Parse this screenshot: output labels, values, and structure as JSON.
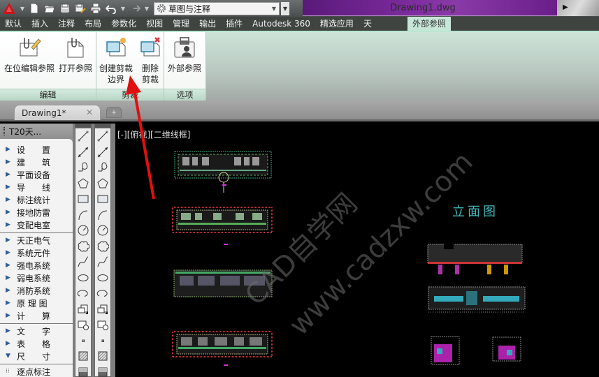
{
  "app": {
    "logo": "autocad-logo",
    "workspace": "草图与注释",
    "document_title": "Drawing1.dwg"
  },
  "quick_access": [
    {
      "icon": "new-file-icon"
    },
    {
      "icon": "open-folder-icon"
    },
    {
      "icon": "save-icon"
    },
    {
      "icon": "save-as-icon"
    },
    {
      "icon": "print-icon"
    },
    {
      "icon": "undo-icon"
    },
    {
      "icon": "redo-icon"
    }
  ],
  "ribbon_tabs": [
    {
      "label": "默认"
    },
    {
      "label": "插入"
    },
    {
      "label": "注释"
    },
    {
      "label": "布局"
    },
    {
      "label": "参数化"
    },
    {
      "label": "视图"
    },
    {
      "label": "管理"
    },
    {
      "label": "输出"
    },
    {
      "label": "插件"
    },
    {
      "label": "Autodesk 360"
    },
    {
      "label": "精选应用"
    },
    {
      "label": "天"
    },
    {
      "label": "外部参照",
      "active": true
    }
  ],
  "ribbon_panels": [
    {
      "title": "编辑",
      "buttons": [
        {
          "label": "在位编辑参照",
          "icon": "edit-reference-in-place-icon"
        },
        {
          "label": "打开参照",
          "icon": "open-reference-icon"
        }
      ]
    },
    {
      "title": "剪裁",
      "buttons": [
        {
          "label_line1": "创建剪裁",
          "label_line2": "边界",
          "icon": "create-clip-boundary-icon"
        },
        {
          "label_line1": "删除",
          "label_line2": "剪裁",
          "icon": "delete-clip-icon"
        }
      ]
    },
    {
      "title": "选项",
      "buttons": [
        {
          "label": "外部参照",
          "icon": "external-references-icon"
        }
      ]
    }
  ],
  "doc_tabs": [
    {
      "label": "Drawing1*",
      "active": true
    }
  ],
  "palette": {
    "title": "T20天...",
    "groups": [
      [
        {
          "a": "设",
          "b": "置"
        },
        {
          "a": "建",
          "b": "筑"
        },
        {
          "label": "平面设备"
        },
        {
          "a": "导",
          "b": "线"
        },
        {
          "label": "标注统计"
        },
        {
          "label": "接地防雷"
        },
        {
          "label": "变配电室"
        }
      ],
      [
        {
          "label": "天正电气"
        },
        {
          "label": "系统元件"
        },
        {
          "label": "强电系统"
        },
        {
          "label": "弱电系统"
        },
        {
          "label": "消防系统"
        },
        {
          "label": "原 理 图"
        },
        {
          "a": "计",
          "b": "算"
        }
      ],
      [
        {
          "a": "文",
          "b": "字"
        },
        {
          "a": "表",
          "b": "格"
        },
        {
          "a": "尺",
          "b": "寸",
          "expanded": true
        }
      ]
    ],
    "subitem": "逐点标注"
  },
  "tools": [
    "line-icon",
    "construction-line-icon",
    "polyline-icon",
    "polygon-icon",
    "rectangle-icon",
    "arc-icon",
    "circle-icon",
    "revision-cloud-icon",
    "spline-icon",
    "ellipse-icon",
    "ellipse-arc-icon",
    "insert-block-icon",
    "make-block-icon",
    "point-icon",
    "hatch-icon",
    "gradient-icon"
  ],
  "canvas": {
    "viewport_label": "[-][俯视][二维线框]",
    "elevation_title": "立面图",
    "watermark_cn": "CAD自学网",
    "watermark_url": "www.cadzxw.com"
  }
}
